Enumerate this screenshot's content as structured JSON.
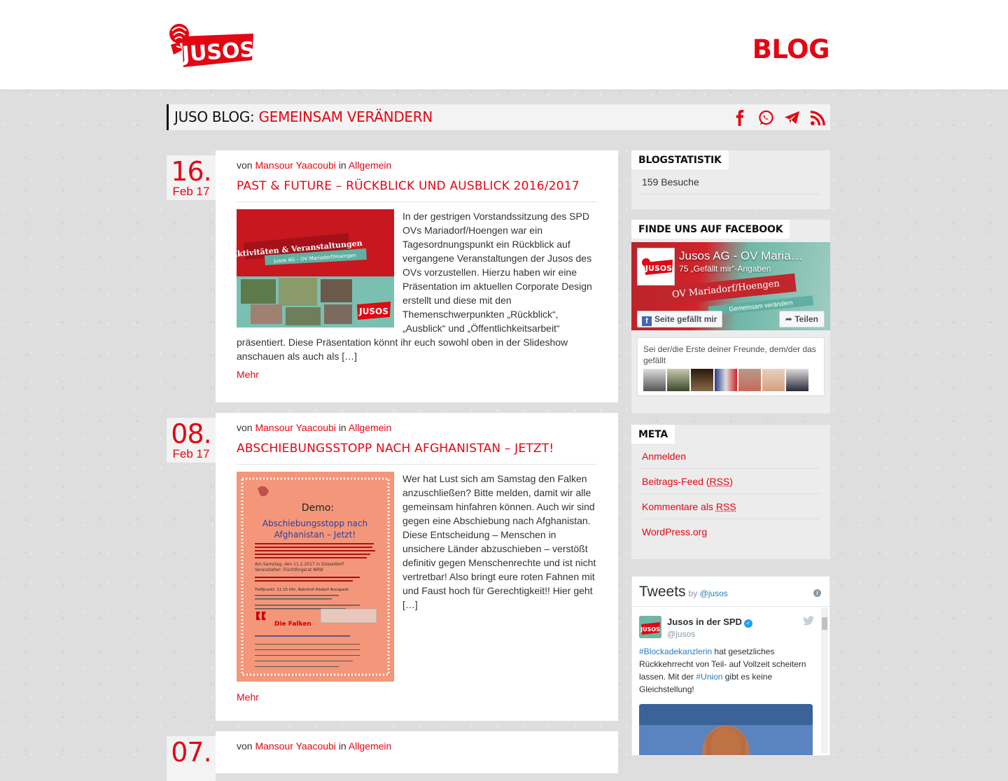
{
  "header": {
    "logo_text": "JUSOS",
    "blog_title": "BLOG"
  },
  "title_bar": {
    "prefix": "JUSO BLOG:",
    "title": "GEMEINSAM VERÄNDERN",
    "share_icons": [
      "facebook-icon",
      "whatsapp-icon",
      "telegram-icon",
      "rss-icon"
    ]
  },
  "posts": [
    {
      "day": "16.",
      "month": "Feb 17",
      "meta_by": "von",
      "author": "Mansour Yaacoubi",
      "meta_in": "in",
      "category": "Allgemein",
      "title": "PAST & FUTURE – RÜCKBLICK UND AUSBLICK 2016/2017",
      "excerpt": "In der gestrigen Vorstandssitzung des SPD OVs Mariadorf/Hoengen war ein Tagesordnungspunkt ein Rückblick auf vergangene Veranstaltungen der Jusos des OVs vorzustellen. Hierzu haben wir eine Präsentation im aktuellen Corporate Design erstellt und diese mit den Themenschwerpunkten „Rückblick“, „Ausblick“ und „Öffentlichkeitsarbeit“ präsentiert. Diese Präsentation könnt ihr euch sowohl oben in der Slideshow anschauen als auch als […]",
      "more": "Mehr",
      "image": {
        "banner_title": "Aktivitäten & Veranstaltungen",
        "banner_sub": "Jusos AG – OV Mariadorf/Hoengen",
        "logo": "JUSOS"
      }
    },
    {
      "day": "08.",
      "month": "Feb 17",
      "meta_by": "von",
      "author": "Mansour Yaacoubi",
      "meta_in": "in",
      "category": "Allgemein",
      "title": "ABSCHIEBUNGSSTOPP NACH AFGHANISTAN – JETZT!",
      "excerpt": "Wer hat Lust sich am Samstag den Falken anzuschließen? Bitte melden, damit wir alle gemeinsam hinfahren können. Auch wir sind gegen eine Abschiebung nach Afghanistan. Diese Entscheidung – Menschen in unsichere Länder abzuschieben – verstößt definitiv gegen Menschenrechte und ist nicht vertretbar! Also bringt eure roten Fahnen mit und Faust hoch für Gerechtigkeit!! Hier geht […]",
      "more": "Mehr",
      "image": {
        "flyer_demo": "Demo:",
        "flyer_title": "Abschiebungsstopp nach Afghanistan – Jetzt!",
        "flyer_date": "Am Samstag, den 11.2.2017 in Düsseldorf",
        "flyer_org": "Veranstalter: Flüchtlingsrat NRW",
        "flyer_meet": "Treffpunkt: 11.15 Uhr, Bahnhof Alsdorf Annapark",
        "flyer_falken": "Die Falken"
      }
    },
    {
      "day": "07.",
      "month": "",
      "meta_by": "von",
      "author": "Mansour Yaacoubi",
      "meta_in": "in",
      "category": "Allgemein"
    }
  ],
  "sidebar": {
    "stats": {
      "title": "BLOGSTATISTIK",
      "visits": "159 Besuche"
    },
    "facebook": {
      "title": "FINDE UNS AUF FACEBOOK",
      "page_name": "Jusos AG - OV Maria…",
      "likes": "75 „Gefällt mir“-Angaben",
      "banner": "OV Mariadorf/Hoengen",
      "banner_sub": "Gemeinsam verändern",
      "like_button": "Seite gefällt mir",
      "share_button": "Teilen",
      "friends_text": "Sei der/die Erste deiner Freunde, dem/der das gefällt",
      "avatar_text": "JUSOS",
      "face_count": 7
    },
    "meta": {
      "title": "META",
      "login": "Anmelden",
      "feed_prefix": "Beitrags-Feed (",
      "feed_abbr": "RSS",
      "feed_suffix": ")",
      "comments_prefix": "Kommentare als ",
      "comments_abbr": "RSS",
      "wordpress": "WordPress.org"
    },
    "twitter": {
      "title": "Tweets",
      "by": "by",
      "handle_link": "@jusos",
      "info": "i",
      "user": "Jusos in der SPD",
      "handle": "@jusos",
      "avatar_text": "JUSOS",
      "hashtag1": "#Blockadekanzlerin",
      "text1": " hat gesetzliches Rückkehrrecht von Teil- auf Vollzeit scheitern lassen. Mit der ",
      "hashtag2": "#Union",
      "text2": " gibt es keine Gleichstellung!"
    }
  },
  "colors": {
    "accent": "#e30613",
    "background": "#dedede",
    "title_bar": "#f3f3f3"
  }
}
